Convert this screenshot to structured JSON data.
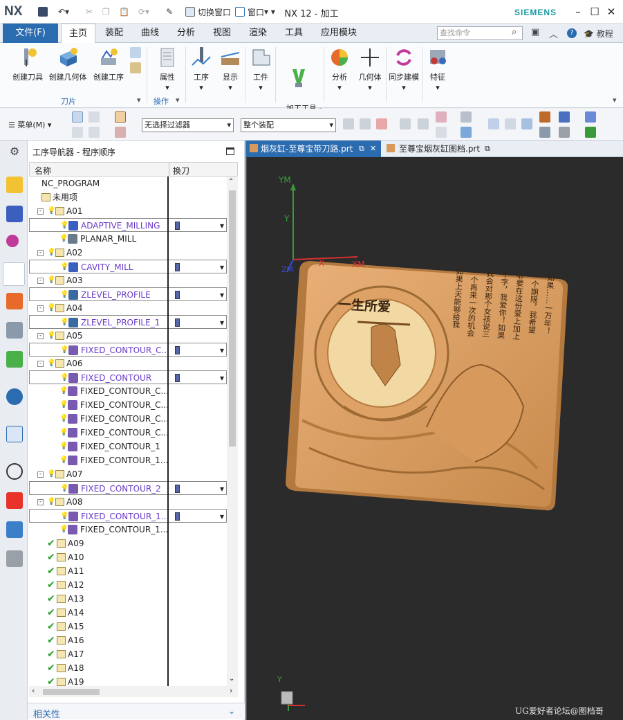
{
  "titlebar": {
    "logo": "NX",
    "switch_window": "切换窗口",
    "window_menu": "窗口",
    "title": "NX 12 - 加工",
    "brand": "SIEMENS"
  },
  "ribbon_tabs": [
    "主页",
    "装配",
    "曲线",
    "分析",
    "视图",
    "渲染",
    "工具",
    "应用模块"
  ],
  "file_tab": "文件(F)",
  "search": {
    "placeholder": "查找命令"
  },
  "tutorial": "教程",
  "ribbon": {
    "buttons": [
      {
        "label": "创建刀具"
      },
      {
        "label": "创建几何体"
      },
      {
        "label": "创建工序"
      },
      {
        "label": "属性"
      },
      {
        "label": "工序"
      },
      {
        "label": "显示"
      },
      {
        "label": "工件"
      },
      {
        "label": "加工工具 -\nGC工具箱"
      },
      {
        "label": "分析"
      },
      {
        "label": "几何体"
      },
      {
        "label": "同步建模"
      },
      {
        "label": "特征"
      }
    ],
    "group_tool": "刀片",
    "group_ops": "操作"
  },
  "toolbar2": {
    "menu": "菜单(M)",
    "filter": "无选择过滤器",
    "assembly": "整个装配"
  },
  "navigator": {
    "title": "工序导航器 - 程序顺序",
    "col_name": "名称",
    "col_tool": "换刀",
    "rows": [
      {
        "name": "NC_PROGRAM",
        "level": 0,
        "kind": "root"
      },
      {
        "name": "未用项",
        "level": 1,
        "kind": "unused"
      },
      {
        "name": "A01",
        "level": 1,
        "kind": "group",
        "status": "bulb",
        "expand": "-"
      },
      {
        "name": "ADAPTIVE_MILLING",
        "level": 2,
        "kind": "op",
        "status": "bulb",
        "selected": true,
        "tool": true,
        "icon": "#3a5fbf"
      },
      {
        "name": "PLANAR_MILL",
        "level": 2,
        "kind": "op",
        "status": "bulb",
        "icon": "#6a7a8a"
      },
      {
        "name": "A02",
        "level": 1,
        "kind": "group",
        "status": "bulb",
        "expand": "-"
      },
      {
        "name": "CAVITY_MILL",
        "level": 2,
        "kind": "op",
        "status": "bulb",
        "selected": true,
        "tool": true,
        "icon": "#3a5fbf"
      },
      {
        "name": "A03",
        "level": 1,
        "kind": "group",
        "status": "bulb",
        "expand": "-"
      },
      {
        "name": "ZLEVEL_PROFILE",
        "level": 2,
        "kind": "op",
        "status": "bulb",
        "selected": true,
        "tool": true,
        "icon": "#3a6a9f"
      },
      {
        "name": "A04",
        "level": 1,
        "kind": "group",
        "status": "bulb",
        "expand": "-"
      },
      {
        "name": "ZLEVEL_PROFILE_1",
        "level": 2,
        "kind": "op",
        "status": "bulb",
        "selected": true,
        "tool": true,
        "icon": "#3a6a9f"
      },
      {
        "name": "A05",
        "level": 1,
        "kind": "group",
        "status": "bulb",
        "expand": "-"
      },
      {
        "name": "FIXED_CONTOUR_C...",
        "level": 2,
        "kind": "op",
        "status": "bulb",
        "selected": true,
        "tool": true,
        "icon": "#7a5ab0"
      },
      {
        "name": "A06",
        "level": 1,
        "kind": "group",
        "status": "bulb",
        "expand": "-"
      },
      {
        "name": "FIXED_CONTOUR",
        "level": 2,
        "kind": "op",
        "status": "bulb",
        "selected": true,
        "tool": true,
        "icon": "#7a5ab0"
      },
      {
        "name": "FIXED_CONTOUR_C...",
        "level": 2,
        "kind": "op",
        "status": "bulb",
        "icon": "#7a5ab0"
      },
      {
        "name": "FIXED_CONTOUR_C...",
        "level": 2,
        "kind": "op",
        "status": "bulb",
        "icon": "#7a5ab0"
      },
      {
        "name": "FIXED_CONTOUR_C...",
        "level": 2,
        "kind": "op",
        "status": "bulb",
        "icon": "#7a5ab0"
      },
      {
        "name": "FIXED_CONTOUR_C...",
        "level": 2,
        "kind": "op",
        "status": "bulb",
        "icon": "#7a5ab0"
      },
      {
        "name": "FIXED_CONTOUR_1",
        "level": 2,
        "kind": "op",
        "status": "bulb",
        "icon": "#7a5ab0"
      },
      {
        "name": "FIXED_CONTOUR_1...",
        "level": 2,
        "kind": "op",
        "status": "bulb",
        "icon": "#7a5ab0"
      },
      {
        "name": "A07",
        "level": 1,
        "kind": "group",
        "status": "bulb",
        "expand": "-"
      },
      {
        "name": "FIXED_CONTOUR_2",
        "level": 2,
        "kind": "op",
        "status": "bulb",
        "selected": true,
        "tool": true,
        "icon": "#7a5ab0"
      },
      {
        "name": "A08",
        "level": 1,
        "kind": "group",
        "status": "bulb",
        "expand": "-"
      },
      {
        "name": "FIXED_CONTOUR_1...",
        "level": 2,
        "kind": "op",
        "status": "bulb",
        "selected": true,
        "tool": true,
        "icon": "#7a5ab0"
      },
      {
        "name": "FIXED_CONTOUR_1...",
        "level": 2,
        "kind": "op",
        "status": "bulb",
        "icon": "#7a5ab0"
      },
      {
        "name": "A09",
        "level": 1,
        "kind": "group",
        "status": "check"
      },
      {
        "name": "A10",
        "level": 1,
        "kind": "group",
        "status": "check"
      },
      {
        "name": "A11",
        "level": 1,
        "kind": "group",
        "status": "check"
      },
      {
        "name": "A12",
        "level": 1,
        "kind": "group",
        "status": "check"
      },
      {
        "name": "A13",
        "level": 1,
        "kind": "group",
        "status": "check"
      },
      {
        "name": "A14",
        "level": 1,
        "kind": "group",
        "status": "check"
      },
      {
        "name": "A15",
        "level": 1,
        "kind": "group",
        "status": "check"
      },
      {
        "name": "A16",
        "level": 1,
        "kind": "group",
        "status": "check"
      },
      {
        "name": "A17",
        "level": 1,
        "kind": "group",
        "status": "check"
      },
      {
        "name": "A18",
        "level": 1,
        "kind": "group",
        "status": "check"
      },
      {
        "name": "A19",
        "level": 1,
        "kind": "group",
        "status": "check"
      }
    ],
    "related": "相关性"
  },
  "view_tabs": [
    {
      "label": "烟灰缸-至尊宝带刀路.prt",
      "active": true
    },
    {
      "label": "至尊宝烟灰缸图档.prt",
      "active": false
    }
  ],
  "viewport": {
    "axis_ym": "YM",
    "axis_y": "Y",
    "axis_x": "X",
    "axis_xm": "XM",
    "axis_zm": "ZM",
    "axis_bottom_y": "Y",
    "plaque_title": "一生所爱",
    "plaque_poem": [
      "如果……一万年！",
      "一个期限，我希望",
      "非要在这份爱上加上",
      "个字，我爱你！如果",
      "我会对那个女孩说三",
      "一个再来一次的机会",
      "如果上天能够给我"
    ]
  },
  "watermark": "UG爱好者论坛@图档哥",
  "colors": {
    "accent": "#2b6cb0",
    "selected_text": "#6a3cc8",
    "plaque": "#d89a5c",
    "viewport_bg": "#2b2b2b",
    "check": "#2aa12a"
  }
}
